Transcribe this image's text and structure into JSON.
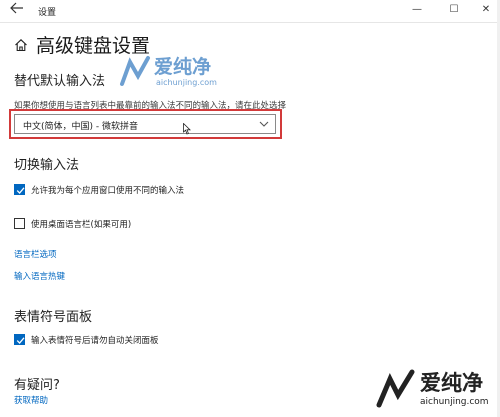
{
  "window": {
    "title": "设置",
    "controls": {
      "minimize": "—",
      "maximize": "☐",
      "close": "✕"
    }
  },
  "page": {
    "title": "高级键盘设置"
  },
  "sections": {
    "override": {
      "heading": "替代默认输入法",
      "description": "如果你想使用与语言列表中最靠前的输入法不同的输入法，请在此处选择",
      "selected": "中文(简体，中国) - 微软拼音"
    },
    "switch": {
      "heading": "切换输入法",
      "checkbox1": "允许我为每个应用窗口使用不同的输入法",
      "checkbox1_checked": true,
      "checkbox2": "使用桌面语言栏(如果可用)",
      "checkbox2_checked": false,
      "link1": "语言栏选项",
      "link2": "输入语言热键"
    },
    "emoji": {
      "heading": "表情符号面板",
      "checkbox": "输入表情符号后请勿自动关闭面板",
      "checkbox_checked": true
    },
    "help": {
      "heading": "有疑问?",
      "link": "获取帮助"
    }
  },
  "watermark": {
    "logo_text": "爱纯净",
    "logo_url": "aichunjing.com",
    "brand_text": "爱纯净",
    "brand_url": "aichunjing.com",
    "color": "#3d7fc2"
  },
  "accent_color": "#0067c0",
  "highlight_color": "#d23a3a"
}
